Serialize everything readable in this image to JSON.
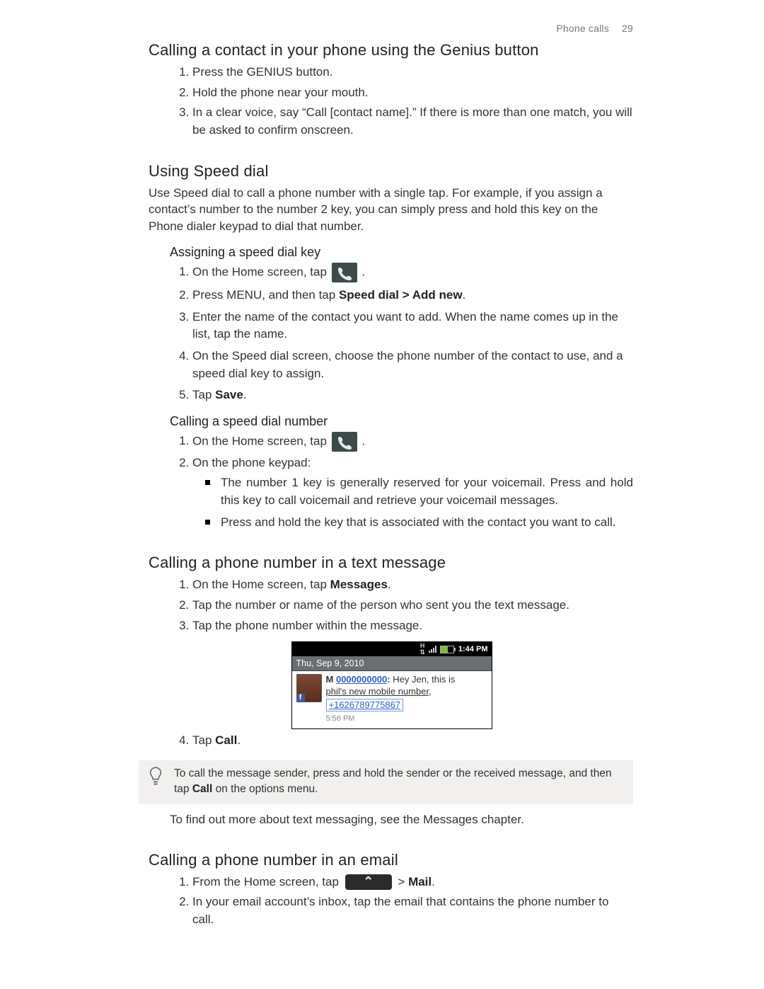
{
  "header": {
    "chapter": "Phone calls",
    "page": "29"
  },
  "sec1": {
    "title": "Calling a contact in your phone using the Genius button",
    "steps": [
      "Press the GENIUS button.",
      "Hold the phone near your mouth.",
      "In a clear voice, say “Call [contact name].” If there is more than one match, you will be asked to confirm onscreen."
    ]
  },
  "sec2": {
    "title": "Using Speed dial",
    "intro": "Use Speed dial to call a phone number with a single tap. For example, if you assign a contact’s number to the number 2 key, you can simply press and hold this key on the Phone dialer keypad to dial that number.",
    "sub_assign": {
      "title": "Assigning a speed dial key",
      "s1_pre": "On the Home screen, tap",
      "s1_post": ".",
      "s2_pre": "Press MENU, and then tap ",
      "s2_bold": "Speed dial > Add new",
      "s2_post": ".",
      "s3": "Enter the name of the contact you want to add. When the name comes up in the list, tap the name.",
      "s4": "On the Speed dial screen, choose the phone number of the contact to use, and a speed dial key to assign.",
      "s5_pre": "Tap ",
      "s5_bold": "Save",
      "s5_post": "."
    },
    "sub_call": {
      "title": "Calling a speed dial number",
      "s1_pre": "On the Home screen, tap",
      "s1_post": ".",
      "s2": "On the phone keypad:",
      "b1": "The number 1 key is generally reserved for your voicemail. Press and hold this key to call voicemail and retrieve your voicemail messages.",
      "b2": "Press and hold the key that is associated with the contact you want to call."
    }
  },
  "sec3": {
    "title": "Calling a phone number in a text message",
    "s1_pre": "On the Home screen, tap ",
    "s1_bold": "Messages",
    "s1_post": ".",
    "s2": "Tap the number or name of the person who sent you the text message.",
    "s3": "Tap the phone number within the message.",
    "s4_pre": "Tap ",
    "s4_bold": "Call",
    "s4_post": ".",
    "msg": {
      "time": "1:44 PM",
      "date": "Thu, Sep 9, 2010",
      "from_label": "M",
      "from_number": "0000000000",
      "body_after_colon1": "Hey Jen, this is",
      "body_line2": "phil's new mobile number,",
      "link_number": "+1626789775867",
      "sent_time": "5:56 PM"
    },
    "tip_pre": "To call the message sender, press and hold the sender or the received message, and then tap ",
    "tip_bold": "Call",
    "tip_post": " on the options menu.",
    "after_tip": "To find out more about text messaging, see the Messages chapter."
  },
  "sec4": {
    "title": "Calling a phone number in an email",
    "s1_pre": "From the Home screen, tap",
    "s1_mid": ">",
    "s1_bold": "Mail",
    "s1_post": ".",
    "s2": "In your email account’s inbox, tap the email that contains the phone number to call."
  }
}
